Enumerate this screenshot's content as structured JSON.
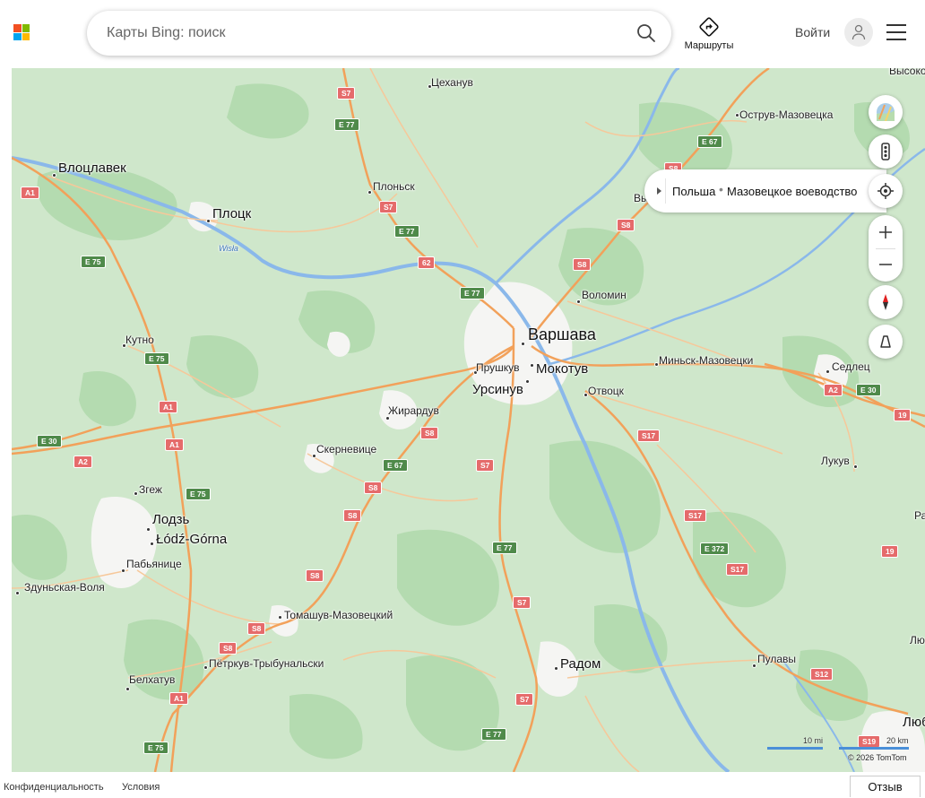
{
  "header": {
    "search_placeholder": "Карты Bing: поиск",
    "routes_label": "Маршруты",
    "signin_label": "Войти"
  },
  "breadcrumb": {
    "country": "Польша",
    "region": "Мазовецкое воеводство"
  },
  "map": {
    "capital": "Варшава",
    "cities": {
      "vloclavek": "Влоцлавек",
      "plock": "Плоцк",
      "kutno": "Кутно",
      "lodz": "Лодзь",
      "lodz_gorna": "Łódź-Górna",
      "zgierz": "Згеж",
      "pabianice": "Пабьянице",
      "zdunska": "Здуньская-Воля",
      "tomaszow": "Томашув-Мазовецкий",
      "piotrkow": "Пётркув-Трыбунальски",
      "belchatow": "Белхатув",
      "skierniewice": "Скерневице",
      "zyrardow": "Жирардув",
      "pruszkow": "Прушкув",
      "mokotow": "Мокотув",
      "ursynow": "Урсинув",
      "otwock": "Отвоцк",
      "radom": "Радом",
      "pulawy": "Пулавы",
      "ciechanow": "Цеханув",
      "plonsk": "Плоньск",
      "ostrow": "Острув-Мазовецка",
      "volomin": "Воломин",
      "minsk": "Миньск-Мазовецки",
      "siedlce": "Седлец",
      "lukow": "Лукув",
      "vysokie": "Высоко",
      "vy": "Вы",
      "lyu": "Лю",
      "lyub": "Люб",
      "ra": "Ра"
    },
    "river": "Wisła",
    "shields": {
      "s7": "S7",
      "s8": "S8",
      "s17": "S17",
      "s12": "S12",
      "s19": "S19",
      "a1": "A1",
      "a2": "A2",
      "n62": "62",
      "n19": "19",
      "e77": "E 77",
      "e67": "E 67",
      "e75": "E 75",
      "e30": "E 30",
      "e372": "E 372"
    },
    "scale": {
      "mi": "10 mi",
      "km": "20 km"
    },
    "copyright": "© 2026 TomTom"
  },
  "footer": {
    "privacy": "Конфиденциальность",
    "terms": "Условия",
    "feedback": "Отзыв"
  },
  "colors": {
    "map_base": "#cfe7cb",
    "forest": "#b4dbb0",
    "urban": "#f5f5f3",
    "water": "#8ab8ea",
    "major_road": "#f2a15a",
    "minor_road": "#f6c89a",
    "s_shield": "#e56b6b",
    "e_shield": "#4f8a4a"
  }
}
